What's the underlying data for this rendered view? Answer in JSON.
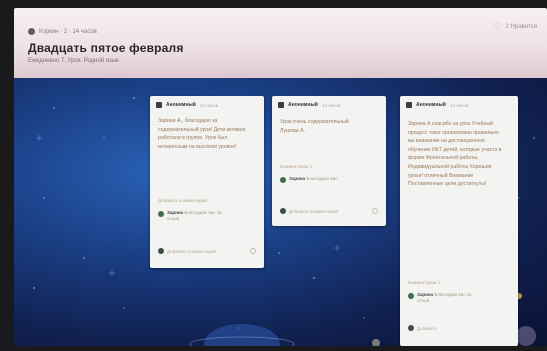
{
  "header": {
    "breadcrumb": "Коркин · 2 · 14 часов",
    "title": "Двадцать пятое февраля",
    "subtitle": "Ежедневно 7. Урок. Родной язык",
    "topright_label": "2 Нравится"
  },
  "cards": [
    {
      "author": "Анонимный",
      "time": "14 часов",
      "body": "Зарина А., благодарю за содержательный урок! Дети активно работали в группе. Урок был интересным на высоком уровне!",
      "section": "Добавить комментарий",
      "comment_name": "Зарина",
      "comment_text": "Благодарю вас за отзыв",
      "foot": "Добавить комментарий"
    },
    {
      "author": "Анонимный",
      "time": "14 часов",
      "body": "Урок очень содержательный. Лушова А.",
      "section": "Комментарии 1",
      "comment_name": "Зарина",
      "comment_text": "Благодарю вас",
      "foot": "Добавить комментарий"
    },
    {
      "author": "Анонимный",
      "time": "14 часов",
      "body": "Зарина А спасибо за урок Учебный процесс тоже организован правильно вы внимание на дистанционное обучение ИКТ детей, которые учатся в форме Фронтальной работы, Индивидуальной работы Хорошие уроки! отличный Внимание Поставленные цели достигнуты!",
      "section": "Комментарии 1",
      "comment_name": "Зарина",
      "comment_text": "Благодарю вас за отзыв",
      "foot": "Добавить"
    }
  ]
}
